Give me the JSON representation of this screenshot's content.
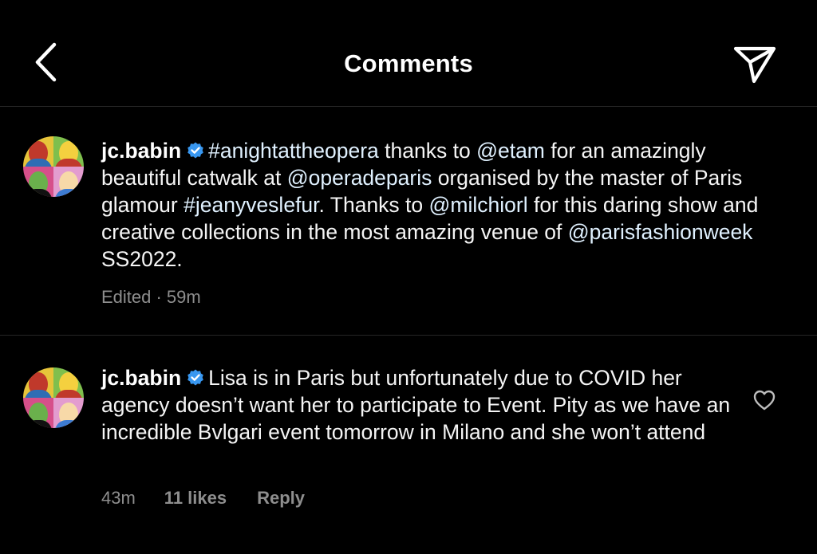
{
  "header": {
    "title": "Comments",
    "back_icon": "chevron-left-icon",
    "share_icon": "paper-plane-icon"
  },
  "colors": {
    "background": "#000000",
    "text": "#f5f5f5",
    "link": "#e0f1ff",
    "meta": "#8e8e8e",
    "verified": "#3897f0",
    "divider": "#262626"
  },
  "comments": [
    {
      "username": "jc.babin",
      "verified": true,
      "segments": [
        {
          "text": "#anightattheopera",
          "link": true
        },
        {
          "text": " thanks to ",
          "link": false
        },
        {
          "text": "@etam",
          "link": true
        },
        {
          "text": " for an amazingly beautiful catwalk at ",
          "link": false
        },
        {
          "text": "@operadeparis",
          "link": true
        },
        {
          "text": " organised by the master of Paris glamour ",
          "link": false
        },
        {
          "text": "#jeanyveslefur",
          "link": true
        },
        {
          "text": ". Thanks to ",
          "link": false
        },
        {
          "text": "@milchiorl",
          "link": true
        },
        {
          "text": " for this daring show and creative collections in the most amazing venue of ",
          "link": false
        },
        {
          "text": "@parisfashionweek",
          "link": true
        },
        {
          "text": " SS2022.",
          "link": false
        }
      ],
      "meta": "Edited · 59m"
    },
    {
      "username": "jc.babin",
      "verified": true,
      "text": "Lisa is in Paris but unfortunately due to COVID her agency doesn’t want her to participate to Event. Pity as we have an incredible Bvlgari event tomorrow in Milano and she won’t attend",
      "time": "43m",
      "likes": "11 likes",
      "reply": "Reply",
      "like_icon": "heart-outline-icon"
    }
  ]
}
